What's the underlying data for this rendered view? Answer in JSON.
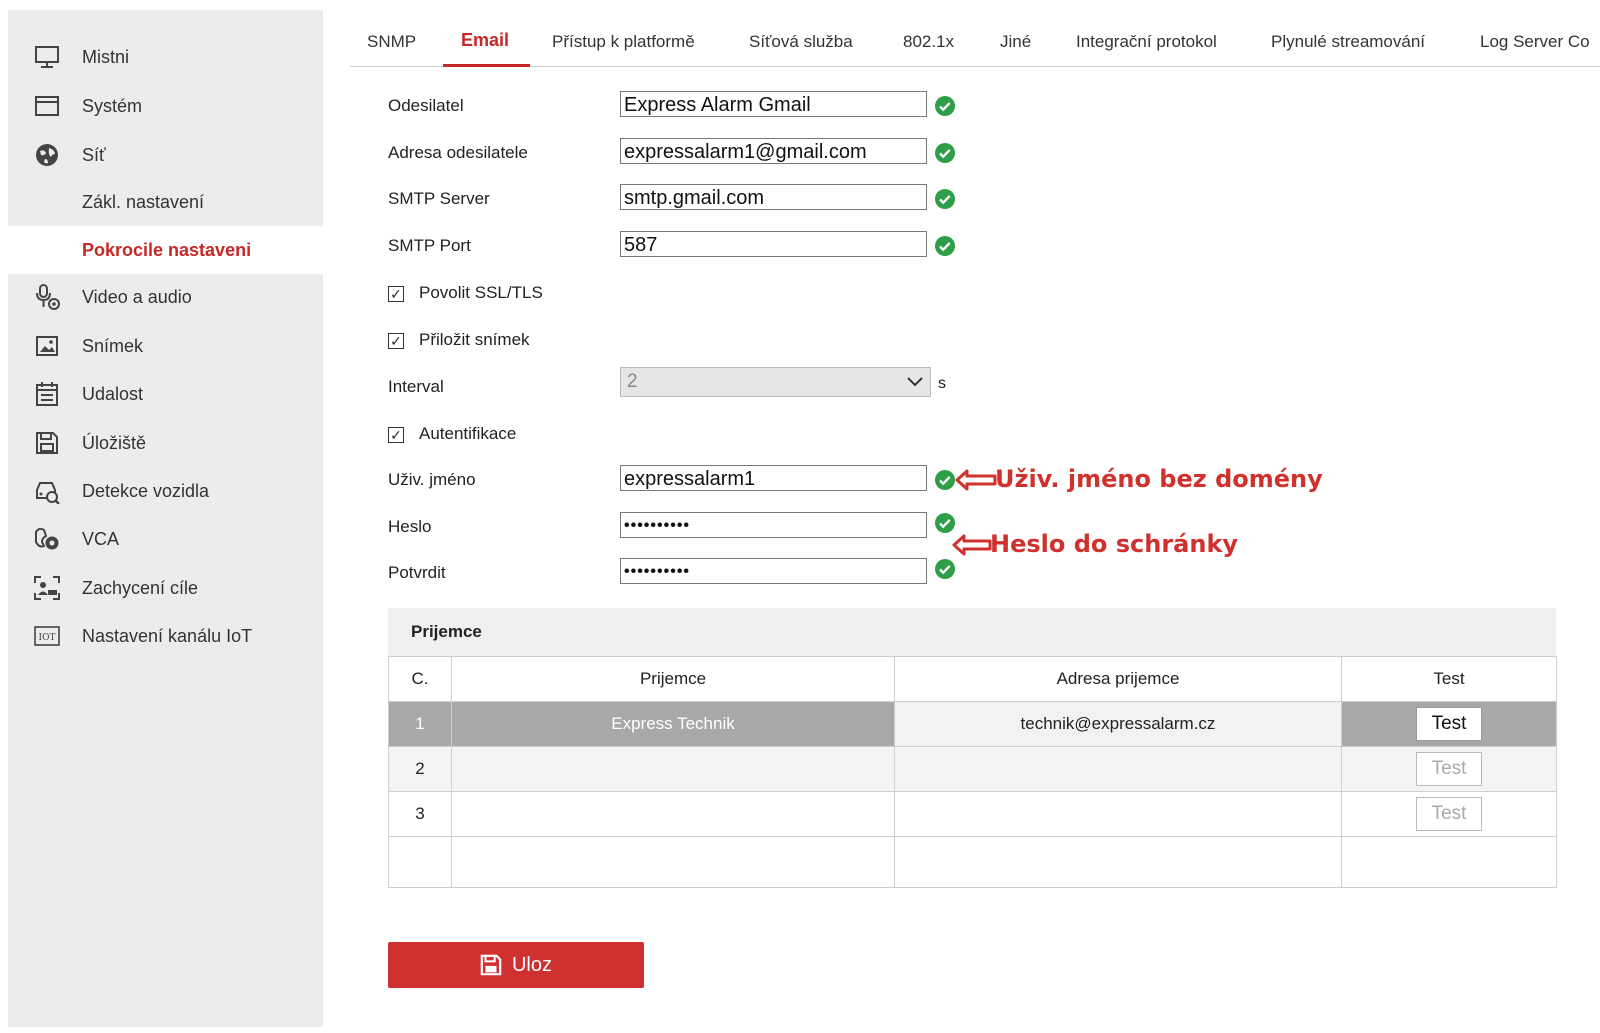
{
  "sidebar": {
    "items": [
      {
        "label": "Mistni",
        "icon": "monitor-icon"
      },
      {
        "label": "Systém",
        "icon": "window-icon"
      },
      {
        "label": "Síť",
        "icon": "globe-icon"
      },
      {
        "label": "Zákl. nastavení",
        "sub": true
      },
      {
        "label": "Pokrocile nastaveni",
        "sub": true,
        "active": true
      },
      {
        "label": "Video a audio",
        "icon": "microphone-camera-icon"
      },
      {
        "label": "Snímek",
        "icon": "image-icon"
      },
      {
        "label": "Udalost",
        "icon": "calendar-icon"
      },
      {
        "label": "Úložiště",
        "icon": "floppy-disk-icon"
      },
      {
        "label": "Detekce vozidla",
        "icon": "vehicle-search-icon"
      },
      {
        "label": "VCA",
        "icon": "vca-icon"
      },
      {
        "label": "Zachycení cíle",
        "icon": "target-capture-icon"
      },
      {
        "label": "Nastavení kanálu IoT",
        "icon": "iot-icon"
      }
    ]
  },
  "tabs": [
    {
      "label": "SNMP"
    },
    {
      "label": "Email",
      "active": true
    },
    {
      "label": "Přístup k platformě"
    },
    {
      "label": "Síťová služba"
    },
    {
      "label": "802.1x"
    },
    {
      "label": "Jiné"
    },
    {
      "label": "Integrační protokol"
    },
    {
      "label": "Plynulé streamování"
    },
    {
      "label": "Log Server Co"
    }
  ],
  "form": {
    "sender_label": "Odesilatel",
    "sender_value": "Express Alarm Gmail",
    "sender_address_label": "Adresa odesilatele",
    "sender_address_value": "expressalarm1@gmail.com",
    "smtp_server_label": "SMTP Server",
    "smtp_server_value": "smtp.gmail.com",
    "smtp_port_label": "SMTP Port",
    "smtp_port_value": "587",
    "ssl_label": "Povolit SSL/TLS",
    "ssl_checked": true,
    "attach_label": "Přiložit snímek",
    "attach_checked": true,
    "interval_label": "Interval",
    "interval_value": "2",
    "interval_unit": "s",
    "auth_label": "Autentifikace",
    "auth_checked": true,
    "username_label": "Uživ. jméno",
    "username_value": "expressalarm1",
    "password_label": "Heslo",
    "password_value": "••••••••••",
    "confirm_label": "Potvrdit",
    "confirm_value": "••••••••••",
    "check_glyph": "✓"
  },
  "annotations": {
    "username_note": "Uživ. jméno bez domény",
    "password_note": "Heslo do schránky",
    "color": "#d0312d"
  },
  "recipients": {
    "title": "Prijemce",
    "columns": [
      "C.",
      "Prijemce",
      "Adresa prijemce",
      "Test"
    ],
    "rows": [
      {
        "no": "1",
        "name": "Express Technik",
        "address": "technik@expressalarm.cz",
        "test": "Test"
      },
      {
        "no": "2",
        "name": "",
        "address": "",
        "test": "Test"
      },
      {
        "no": "3",
        "name": "",
        "address": "",
        "test": "Test"
      }
    ]
  },
  "save_label": "Uloz",
  "colors": {
    "accent": "#c62828",
    "ok": "#2e9e47",
    "sidebar": "#ececec"
  }
}
